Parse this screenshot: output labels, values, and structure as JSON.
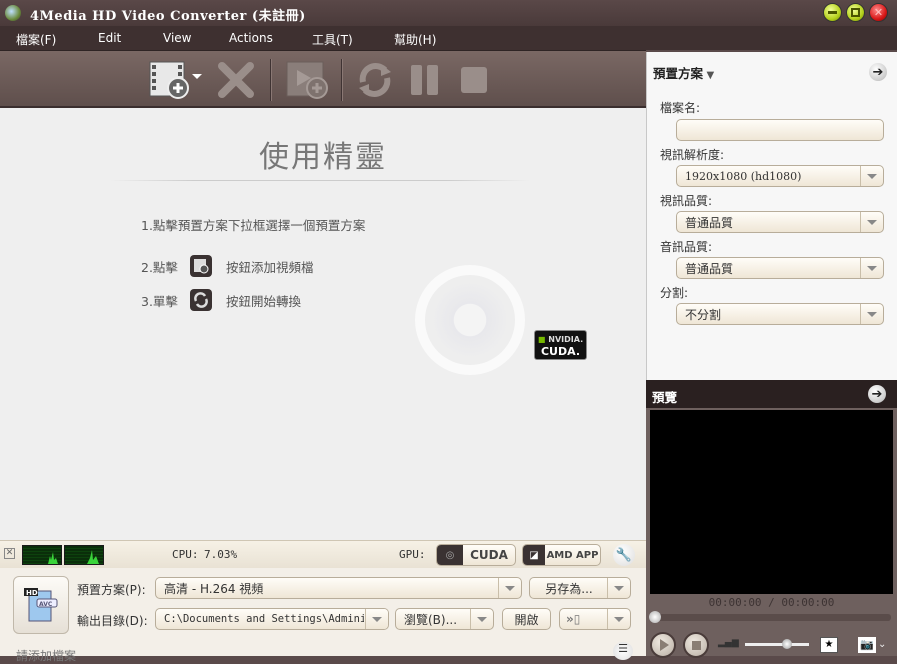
{
  "window": {
    "title": "4Media HD Video Converter (未註冊)",
    "minimize_label": "–",
    "maximize_label": "▣",
    "close_label": "✕"
  },
  "menu": {
    "items": [
      {
        "label": "檔案(F)"
      },
      {
        "label": "Edit"
      },
      {
        "label": "View"
      },
      {
        "label": "Actions"
      },
      {
        "label": "工具(T)"
      },
      {
        "label": "幫助(H)"
      }
    ]
  },
  "toolbar": {
    "buttons": [
      {
        "name": "add-video",
        "icon": "film-add-icon",
        "enabled": true,
        "has_dropdown": true
      },
      {
        "name": "remove",
        "icon": "x-icon",
        "enabled": false
      },
      {
        "name": "add-segment",
        "icon": "film-segment-add-icon",
        "enabled": false
      },
      {
        "name": "convert",
        "icon": "convert-arrows-icon",
        "enabled": false
      },
      {
        "name": "pause",
        "icon": "pause-icon",
        "enabled": false
      },
      {
        "name": "stop",
        "icon": "stop-icon",
        "enabled": false
      }
    ]
  },
  "wizard": {
    "title": "使用精靈",
    "step1": "1.點擊預置方案下拉框選擇一個預置方案",
    "step2_prefix": "2.點擊",
    "step2_suffix": "按鈕添加視頻檔",
    "step3_prefix": "3.單擊",
    "step3_suffix": "按鈕開始轉換",
    "badge_brand": "NVIDIA.",
    "badge_product": "CUDA."
  },
  "status": {
    "cpu_label": "CPU:",
    "cpu_value": "7.03%",
    "gpu_label": "GPU:",
    "cuda_label": "CUDA",
    "amd_label": "AMD APP"
  },
  "bottom": {
    "profile_label": "預置方案(P):",
    "profile_value": "高清 - H.264 視頻",
    "save_as_label": "另存為...",
    "output_label": "輸出目錄(D):",
    "output_value": "C:\\Documents and Settings\\Adminis",
    "browse_label": "瀏覽(B)...",
    "open_label": "開啟",
    "status_text": "請添加檔案"
  },
  "profile_panel": {
    "header": "預置方案",
    "file_name_label": "檔案名:",
    "file_name_value": "",
    "resolution_label": "視訊解析度:",
    "resolution_value": "1920x1080 (hd1080)",
    "video_quality_label": "視訊品質:",
    "video_quality_value": "普通品質",
    "audio_quality_label": "音訊品質:",
    "audio_quality_value": "普通品質",
    "split_label": "分割:",
    "split_value": "不分割"
  },
  "preview": {
    "header": "預覽",
    "time": "00:00:00 / 00:00:00",
    "seek_position": 0,
    "volume_level": 0.65
  }
}
